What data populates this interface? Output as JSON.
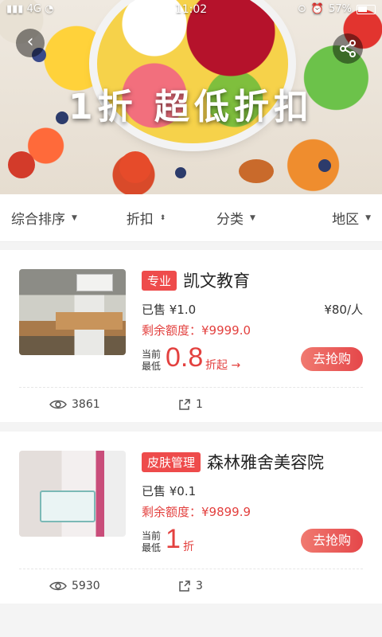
{
  "status_bar": {
    "network": "4G",
    "time": "11:02",
    "battery": "57%"
  },
  "hero": {
    "title": "1折 超低折扣",
    "back_icon": "chevron-left-icon",
    "share_icon": "share-icon"
  },
  "filters": [
    {
      "label": "综合排序",
      "icon": "caret-down-icon"
    },
    {
      "label": "折扣",
      "icon": "sort-updown-icon"
    },
    {
      "label": "分类",
      "icon": "caret-down-icon"
    },
    {
      "label": "地区",
      "icon": "caret-down-icon"
    }
  ],
  "cards": [
    {
      "badge": "专业",
      "name": "凯文教育",
      "sold": "已售 ¥1.0",
      "price_per": "¥80/人",
      "quota": "剩余额度：¥9999.0",
      "disc_label": "当前最低",
      "disc_value": "0.8",
      "disc_unit": "折起 →",
      "buy_label": "去抢购",
      "views": "3861",
      "shares": "1"
    },
    {
      "badge": "皮肤管理",
      "name": "森林雅舍美容院",
      "sold": "已售 ¥0.1",
      "price_per": "",
      "quota": "剩余额度：¥9899.9",
      "disc_label": "当前最低",
      "disc_value": "1",
      "disc_unit": "折",
      "buy_label": "去抢购",
      "views": "5930",
      "shares": "3"
    }
  ],
  "colors": {
    "accent": "#e3413f",
    "badge": "#ee4b4b",
    "button_gradient_start": "#f07a70",
    "button_gradient_end": "#e5474a"
  }
}
